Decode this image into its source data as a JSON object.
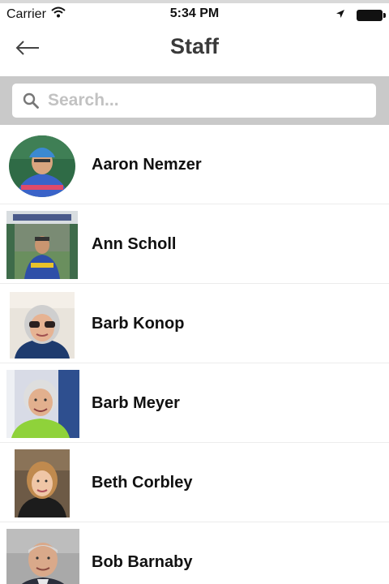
{
  "status_bar": {
    "carrier": "Carrier",
    "time": "5:34 PM"
  },
  "nav": {
    "title": "Staff",
    "back_icon": "back-arrow-icon"
  },
  "search": {
    "placeholder": "Search...",
    "value": "",
    "icon": "search-icon"
  },
  "staff": [
    {
      "name": "Aaron Nemzer"
    },
    {
      "name": "Ann Scholl"
    },
    {
      "name": "Barb Konop"
    },
    {
      "name": "Barb Meyer"
    },
    {
      "name": "Beth Corbley"
    },
    {
      "name": "Bob Barnaby"
    }
  ],
  "colors": {
    "search_background": "#c9c9c9",
    "title_text": "#3a3a3a",
    "placeholder_text": "#c2c2c2"
  }
}
